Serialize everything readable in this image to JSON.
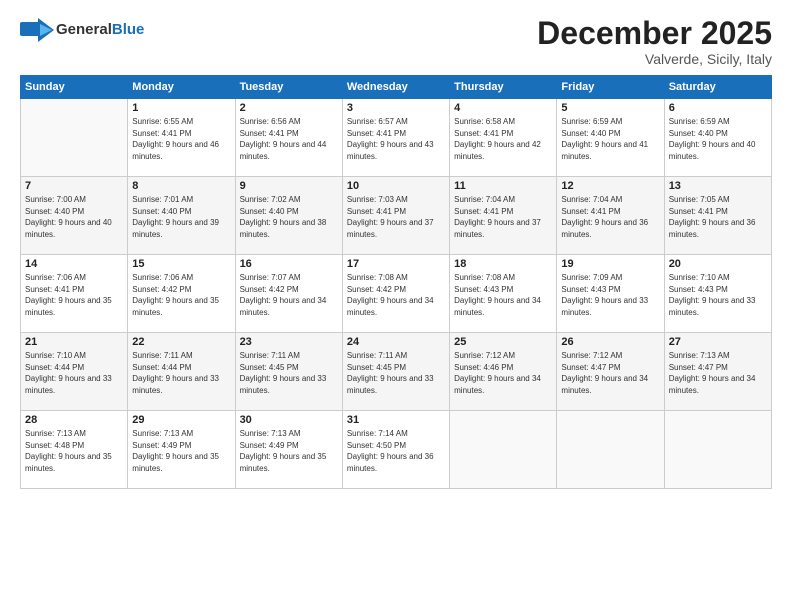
{
  "header": {
    "logo_general": "General",
    "logo_blue": "Blue",
    "month_title": "December 2025",
    "subtitle": "Valverde, Sicily, Italy"
  },
  "days_of_week": [
    "Sunday",
    "Monday",
    "Tuesday",
    "Wednesday",
    "Thursday",
    "Friday",
    "Saturday"
  ],
  "weeks": [
    [
      {
        "day": "",
        "empty": true
      },
      {
        "day": "1",
        "sunrise": "Sunrise: 6:55 AM",
        "sunset": "Sunset: 4:41 PM",
        "daylight": "Daylight: 9 hours and 46 minutes."
      },
      {
        "day": "2",
        "sunrise": "Sunrise: 6:56 AM",
        "sunset": "Sunset: 4:41 PM",
        "daylight": "Daylight: 9 hours and 44 minutes."
      },
      {
        "day": "3",
        "sunrise": "Sunrise: 6:57 AM",
        "sunset": "Sunset: 4:41 PM",
        "daylight": "Daylight: 9 hours and 43 minutes."
      },
      {
        "day": "4",
        "sunrise": "Sunrise: 6:58 AM",
        "sunset": "Sunset: 4:41 PM",
        "daylight": "Daylight: 9 hours and 42 minutes."
      },
      {
        "day": "5",
        "sunrise": "Sunrise: 6:59 AM",
        "sunset": "Sunset: 4:40 PM",
        "daylight": "Daylight: 9 hours and 41 minutes."
      },
      {
        "day": "6",
        "sunrise": "Sunrise: 6:59 AM",
        "sunset": "Sunset: 4:40 PM",
        "daylight": "Daylight: 9 hours and 40 minutes."
      }
    ],
    [
      {
        "day": "7",
        "sunrise": "Sunrise: 7:00 AM",
        "sunset": "Sunset: 4:40 PM",
        "daylight": "Daylight: 9 hours and 40 minutes."
      },
      {
        "day": "8",
        "sunrise": "Sunrise: 7:01 AM",
        "sunset": "Sunset: 4:40 PM",
        "daylight": "Daylight: 9 hours and 39 minutes."
      },
      {
        "day": "9",
        "sunrise": "Sunrise: 7:02 AM",
        "sunset": "Sunset: 4:40 PM",
        "daylight": "Daylight: 9 hours and 38 minutes."
      },
      {
        "day": "10",
        "sunrise": "Sunrise: 7:03 AM",
        "sunset": "Sunset: 4:41 PM",
        "daylight": "Daylight: 9 hours and 37 minutes."
      },
      {
        "day": "11",
        "sunrise": "Sunrise: 7:04 AM",
        "sunset": "Sunset: 4:41 PM",
        "daylight": "Daylight: 9 hours and 37 minutes."
      },
      {
        "day": "12",
        "sunrise": "Sunrise: 7:04 AM",
        "sunset": "Sunset: 4:41 PM",
        "daylight": "Daylight: 9 hours and 36 minutes."
      },
      {
        "day": "13",
        "sunrise": "Sunrise: 7:05 AM",
        "sunset": "Sunset: 4:41 PM",
        "daylight": "Daylight: 9 hours and 36 minutes."
      }
    ],
    [
      {
        "day": "14",
        "sunrise": "Sunrise: 7:06 AM",
        "sunset": "Sunset: 4:41 PM",
        "daylight": "Daylight: 9 hours and 35 minutes."
      },
      {
        "day": "15",
        "sunrise": "Sunrise: 7:06 AM",
        "sunset": "Sunset: 4:42 PM",
        "daylight": "Daylight: 9 hours and 35 minutes."
      },
      {
        "day": "16",
        "sunrise": "Sunrise: 7:07 AM",
        "sunset": "Sunset: 4:42 PM",
        "daylight": "Daylight: 9 hours and 34 minutes."
      },
      {
        "day": "17",
        "sunrise": "Sunrise: 7:08 AM",
        "sunset": "Sunset: 4:42 PM",
        "daylight": "Daylight: 9 hours and 34 minutes."
      },
      {
        "day": "18",
        "sunrise": "Sunrise: 7:08 AM",
        "sunset": "Sunset: 4:43 PM",
        "daylight": "Daylight: 9 hours and 34 minutes."
      },
      {
        "day": "19",
        "sunrise": "Sunrise: 7:09 AM",
        "sunset": "Sunset: 4:43 PM",
        "daylight": "Daylight: 9 hours and 33 minutes."
      },
      {
        "day": "20",
        "sunrise": "Sunrise: 7:10 AM",
        "sunset": "Sunset: 4:43 PM",
        "daylight": "Daylight: 9 hours and 33 minutes."
      }
    ],
    [
      {
        "day": "21",
        "sunrise": "Sunrise: 7:10 AM",
        "sunset": "Sunset: 4:44 PM",
        "daylight": "Daylight: 9 hours and 33 minutes."
      },
      {
        "day": "22",
        "sunrise": "Sunrise: 7:11 AM",
        "sunset": "Sunset: 4:44 PM",
        "daylight": "Daylight: 9 hours and 33 minutes."
      },
      {
        "day": "23",
        "sunrise": "Sunrise: 7:11 AM",
        "sunset": "Sunset: 4:45 PM",
        "daylight": "Daylight: 9 hours and 33 minutes."
      },
      {
        "day": "24",
        "sunrise": "Sunrise: 7:11 AM",
        "sunset": "Sunset: 4:45 PM",
        "daylight": "Daylight: 9 hours and 33 minutes."
      },
      {
        "day": "25",
        "sunrise": "Sunrise: 7:12 AM",
        "sunset": "Sunset: 4:46 PM",
        "daylight": "Daylight: 9 hours and 34 minutes."
      },
      {
        "day": "26",
        "sunrise": "Sunrise: 7:12 AM",
        "sunset": "Sunset: 4:47 PM",
        "daylight": "Daylight: 9 hours and 34 minutes."
      },
      {
        "day": "27",
        "sunrise": "Sunrise: 7:13 AM",
        "sunset": "Sunset: 4:47 PM",
        "daylight": "Daylight: 9 hours and 34 minutes."
      }
    ],
    [
      {
        "day": "28",
        "sunrise": "Sunrise: 7:13 AM",
        "sunset": "Sunset: 4:48 PM",
        "daylight": "Daylight: 9 hours and 35 minutes."
      },
      {
        "day": "29",
        "sunrise": "Sunrise: 7:13 AM",
        "sunset": "Sunset: 4:49 PM",
        "daylight": "Daylight: 9 hours and 35 minutes."
      },
      {
        "day": "30",
        "sunrise": "Sunrise: 7:13 AM",
        "sunset": "Sunset: 4:49 PM",
        "daylight": "Daylight: 9 hours and 35 minutes."
      },
      {
        "day": "31",
        "sunrise": "Sunrise: 7:14 AM",
        "sunset": "Sunset: 4:50 PM",
        "daylight": "Daylight: 9 hours and 36 minutes."
      },
      {
        "day": "",
        "empty": true
      },
      {
        "day": "",
        "empty": true
      },
      {
        "day": "",
        "empty": true
      }
    ]
  ]
}
